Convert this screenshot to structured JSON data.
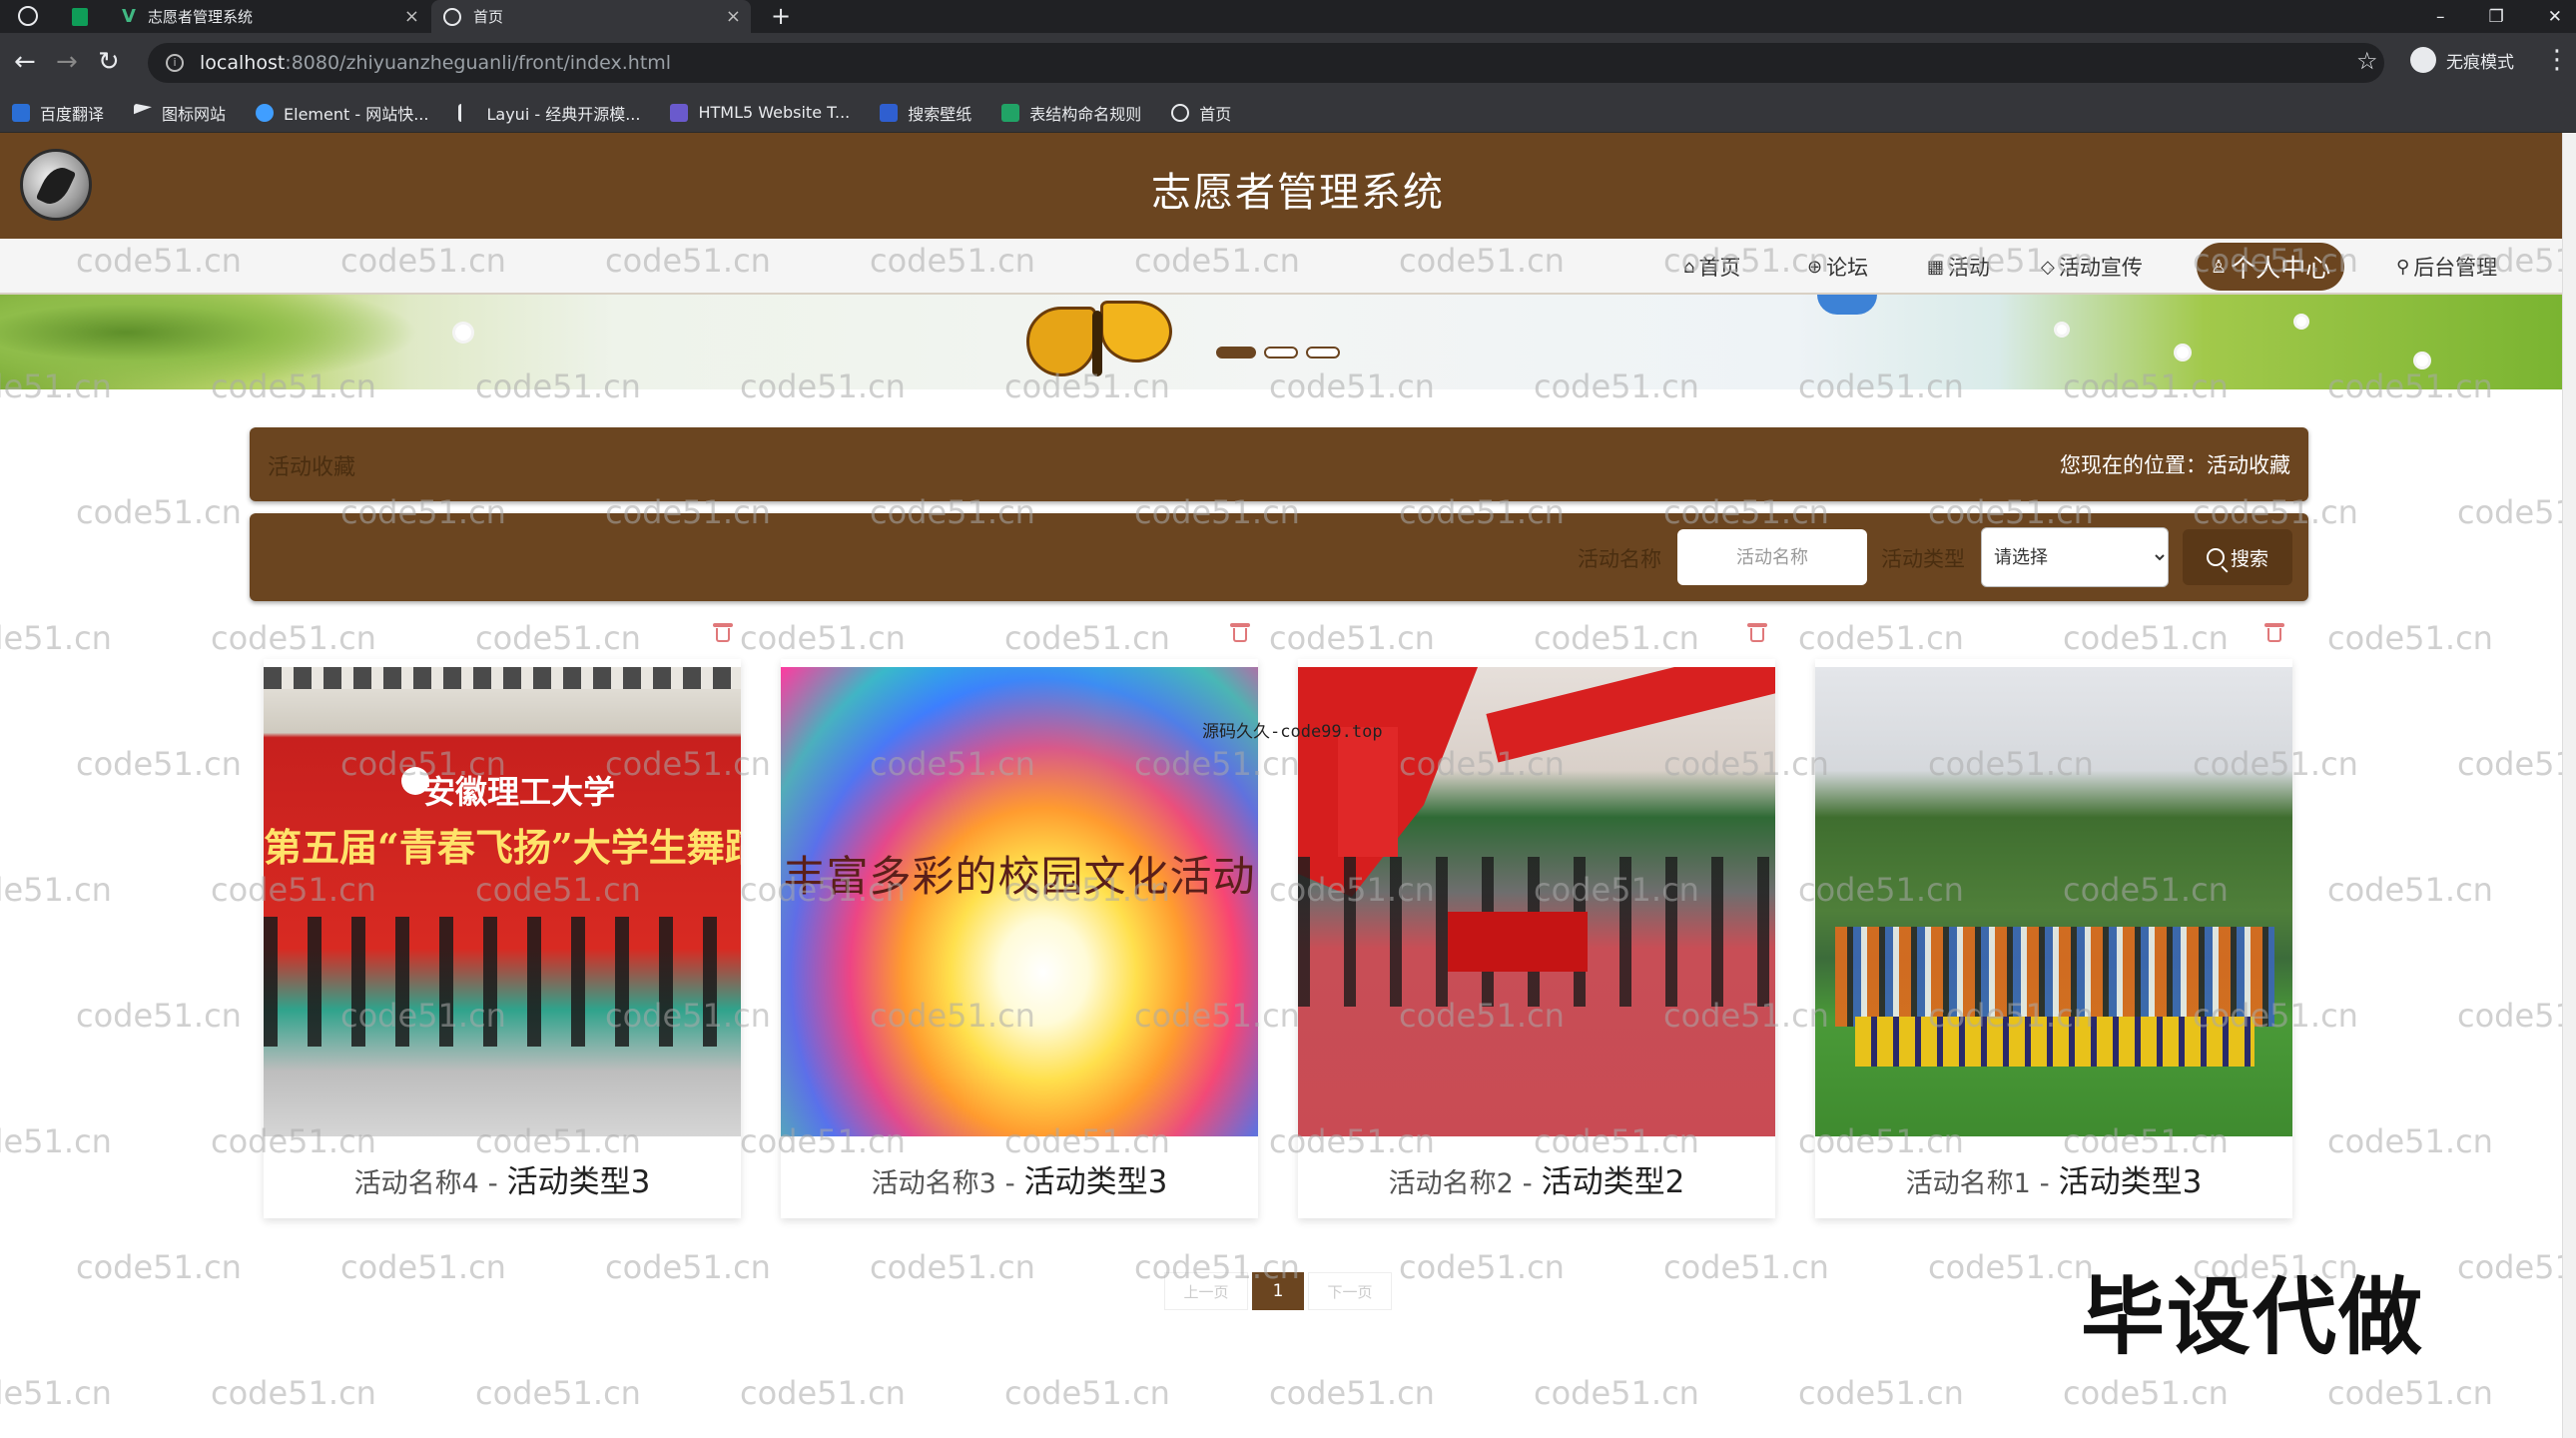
{
  "browser": {
    "tabs": [
      {
        "title": "志愿者管理系统"
      },
      {
        "title": "首页"
      }
    ],
    "url_host": "localhost",
    "url_path": ":8080/zhiyuanzheguanli/front/index.html",
    "incognito_label": "无痕模式",
    "bookmarks": [
      "百度翻译",
      "图标网站",
      "Element - 网站快...",
      "Layui - 经典开源模...",
      "HTML5 Website T...",
      "搜索壁纸",
      "表结构命名规则",
      "首页"
    ]
  },
  "site": {
    "title": "志愿者管理系统",
    "nav": [
      {
        "label": "首页",
        "icon": "home-icon"
      },
      {
        "label": "论坛",
        "icon": "globe-icon"
      },
      {
        "label": "活动",
        "icon": "calendar-icon"
      },
      {
        "label": "活动宣传",
        "icon": "tag-icon"
      },
      {
        "label": "个人中心",
        "icon": "user-icon",
        "active": true
      },
      {
        "label": "后台管理",
        "icon": "link-icon"
      }
    ]
  },
  "breadcrumb": {
    "title": "活动收藏",
    "location": "您现在的位置：活动收藏"
  },
  "search": {
    "name_label": "活动名称",
    "name_placeholder": "活动名称",
    "type_label": "活动类型",
    "type_selected": "请选择",
    "button_label": "搜索"
  },
  "cards": [
    {
      "name": "活动名称4",
      "type": "活动类型3"
    },
    {
      "name": "活动名称3",
      "type": "活动类型3"
    },
    {
      "name": "活动名称2",
      "type": "活动类型2"
    },
    {
      "name": "活动名称1",
      "type": "活动类型3"
    }
  ],
  "card_images": {
    "img1_uni": "安徽理工大学",
    "img1_slogan": "第五届“青春飞扬”大学生舞蹈大",
    "img2_text": "丰富多彩的校园文化活动"
  },
  "pagination": {
    "prev": "上一页",
    "current": "1",
    "next": "下一页"
  },
  "watermarks": {
    "repeat": "code51.cn",
    "center": "源码久久-code99.top",
    "big": "毕设代做"
  },
  "colors": {
    "primary_brown": "#6b4520",
    "header_text": "#ffffff"
  }
}
